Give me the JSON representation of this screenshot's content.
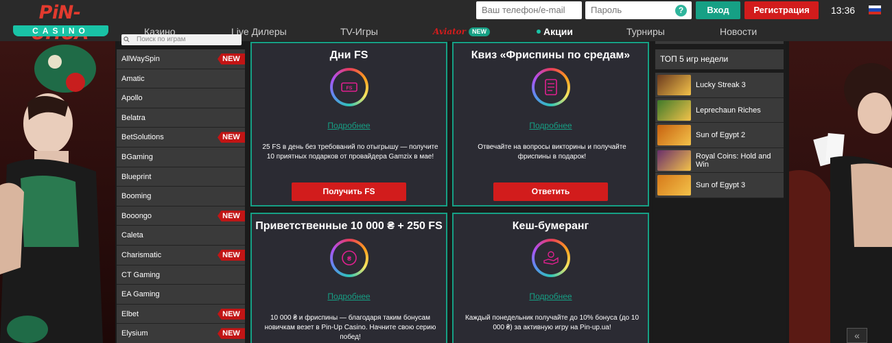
{
  "header": {
    "logo_top": "PiN-UP.UA",
    "logo_bottom": "CASINO",
    "phone_placeholder": "Ваш телефон/e-mail",
    "password_placeholder": "Пароль",
    "help_glyph": "?",
    "login_label": "Вход",
    "register_label": "Регистрация",
    "time": "13:36",
    "flag_icon": "russia-flag-icon"
  },
  "nav": {
    "casino": "Казино",
    "live": "Live Дилеры",
    "tv": "TV-Игры",
    "aviator": "Aviator",
    "aviator_badge": "NEW",
    "promotions": "Акции",
    "tournaments": "Турниры",
    "news": "Новости"
  },
  "providers": {
    "search_placeholder": "Поиск по играм",
    "new_badge": "NEW",
    "items": [
      {
        "label": "AllWaySpin",
        "new": true
      },
      {
        "label": "Amatic",
        "new": false
      },
      {
        "label": "Apollo",
        "new": false
      },
      {
        "label": "Belatra",
        "new": false
      },
      {
        "label": "BetSolutions",
        "new": true
      },
      {
        "label": "BGaming",
        "new": false
      },
      {
        "label": "Blueprint",
        "new": false
      },
      {
        "label": "Booming",
        "new": false
      },
      {
        "label": "Booongo",
        "new": true
      },
      {
        "label": "Caleta",
        "new": false
      },
      {
        "label": "Charismatic",
        "new": true
      },
      {
        "label": "CT Gaming",
        "new": false
      },
      {
        "label": "EA Gaming",
        "new": false
      },
      {
        "label": "Elbet",
        "new": true
      },
      {
        "label": "Elysium",
        "new": true
      }
    ]
  },
  "promos": [
    {
      "title": "Дни FS",
      "icon": "free-spins-slot-icon",
      "link": "Подробнее",
      "desc": "25 FS в день без требований по отыгрышу — получите 10 приятных подарков от провайдера Gamzix в мае!",
      "button": "Получить FS"
    },
    {
      "title": "Квиз «Фриспины по средам»",
      "icon": "quiz-checklist-icon",
      "link": "Подробнее",
      "desc": "Отвечайте на вопросы викторины и получайте фриспины в подарок!",
      "button": "Ответить"
    },
    {
      "title": "Приветственные 10 000 ₴ + 250 FS",
      "icon": "welcome-bonus-coin-icon",
      "link": "Подробнее",
      "desc": "10 000 ₴ и фриспины — благодаря таким бонусам новичкам везет в Pin-Up Casino. Начните свою серию побед!"
    },
    {
      "title": "Кеш-бумеранг",
      "icon": "cashback-hand-icon",
      "link": "Подробнее",
      "desc": "Каждый понедельник получайте до 10% бонуса (до 10 000 ₴) за активную игру на Pin-up.ua!"
    }
  ],
  "top_games": {
    "title": "ТОП 5 игр недели",
    "items": [
      {
        "name": "Lucky Streak 3",
        "color": "#6b3a1e"
      },
      {
        "name": "Leprechaun Riches",
        "color": "#3f7a2a"
      },
      {
        "name": "Sun of Egypt 2",
        "color": "#c7610f"
      },
      {
        "name": "Royal Coins: Hold and Win",
        "color": "#6a2f6b"
      },
      {
        "name": "Sun of Egypt 3",
        "color": "#d6791a"
      }
    ]
  },
  "corner": {
    "scroll_glyph": "«"
  }
}
